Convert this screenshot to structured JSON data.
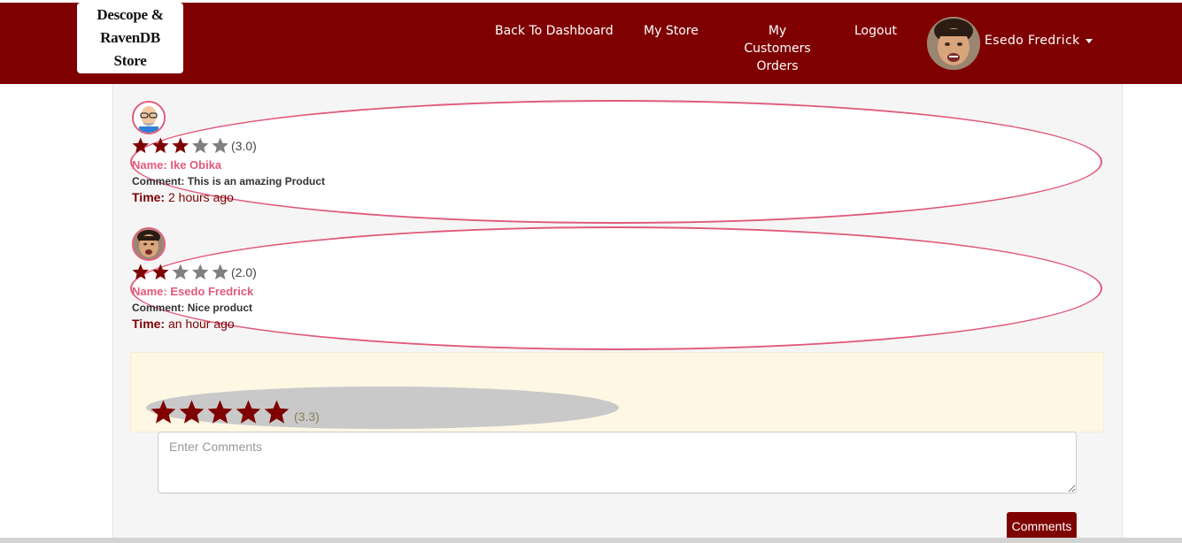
{
  "brand": {
    "line1": "Descope & RavenDB",
    "line2": "Store"
  },
  "nav": {
    "back": "Back To Dashboard",
    "store": "My Store",
    "orders_line1": "My Customers",
    "orders_line2": "Orders",
    "logout": "Logout",
    "user_name": "Esedo Fredrick"
  },
  "reviews": [
    {
      "rating": 3,
      "rating_text": "(3.0)",
      "name": "Name: Ike Obika",
      "comment_label": "Comment:",
      "comment": "This is an amazing Product",
      "time_label": "Time:",
      "time": "2 hours ago"
    },
    {
      "rating": 2,
      "rating_text": "(2.0)",
      "name": "Name: Esedo Fredrick",
      "comment_label": "Comment:",
      "comment": "Nice product",
      "time_label": "Time:",
      "time": "an hour ago"
    }
  ],
  "rating_input": {
    "stars": 5,
    "value_text": "(3.3)"
  },
  "comment_input": {
    "placeholder": "Enter Comments",
    "value": ""
  },
  "submit_label": "Comments",
  "colors": {
    "primary": "#7f0000",
    "accent_pink": "#e05a7a",
    "star_filled": "#7f0000",
    "star_empty": "#808080",
    "panel_bg": "#fdf7e4"
  }
}
